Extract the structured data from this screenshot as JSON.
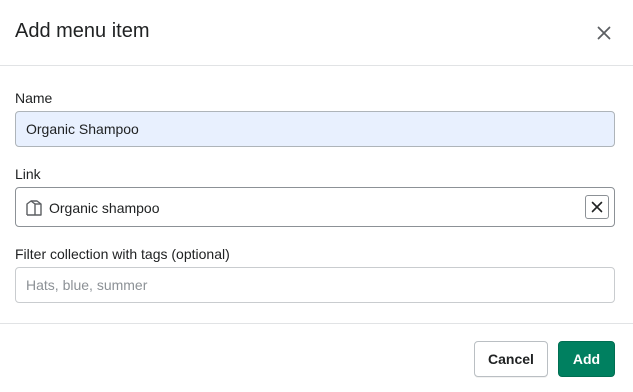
{
  "modal": {
    "title": "Add menu item"
  },
  "form": {
    "name": {
      "label": "Name",
      "value": "Organic Shampoo"
    },
    "link": {
      "label": "Link",
      "value": "Organic shampoo",
      "icon": "collection-icon"
    },
    "tags": {
      "label": "Filter collection with tags (optional)",
      "placeholder": "Hats, blue, summer",
      "value": ""
    }
  },
  "footer": {
    "cancel_label": "Cancel",
    "add_label": "Add"
  },
  "colors": {
    "primary": "#008060",
    "autofill_bg": "#e8f0fe"
  }
}
